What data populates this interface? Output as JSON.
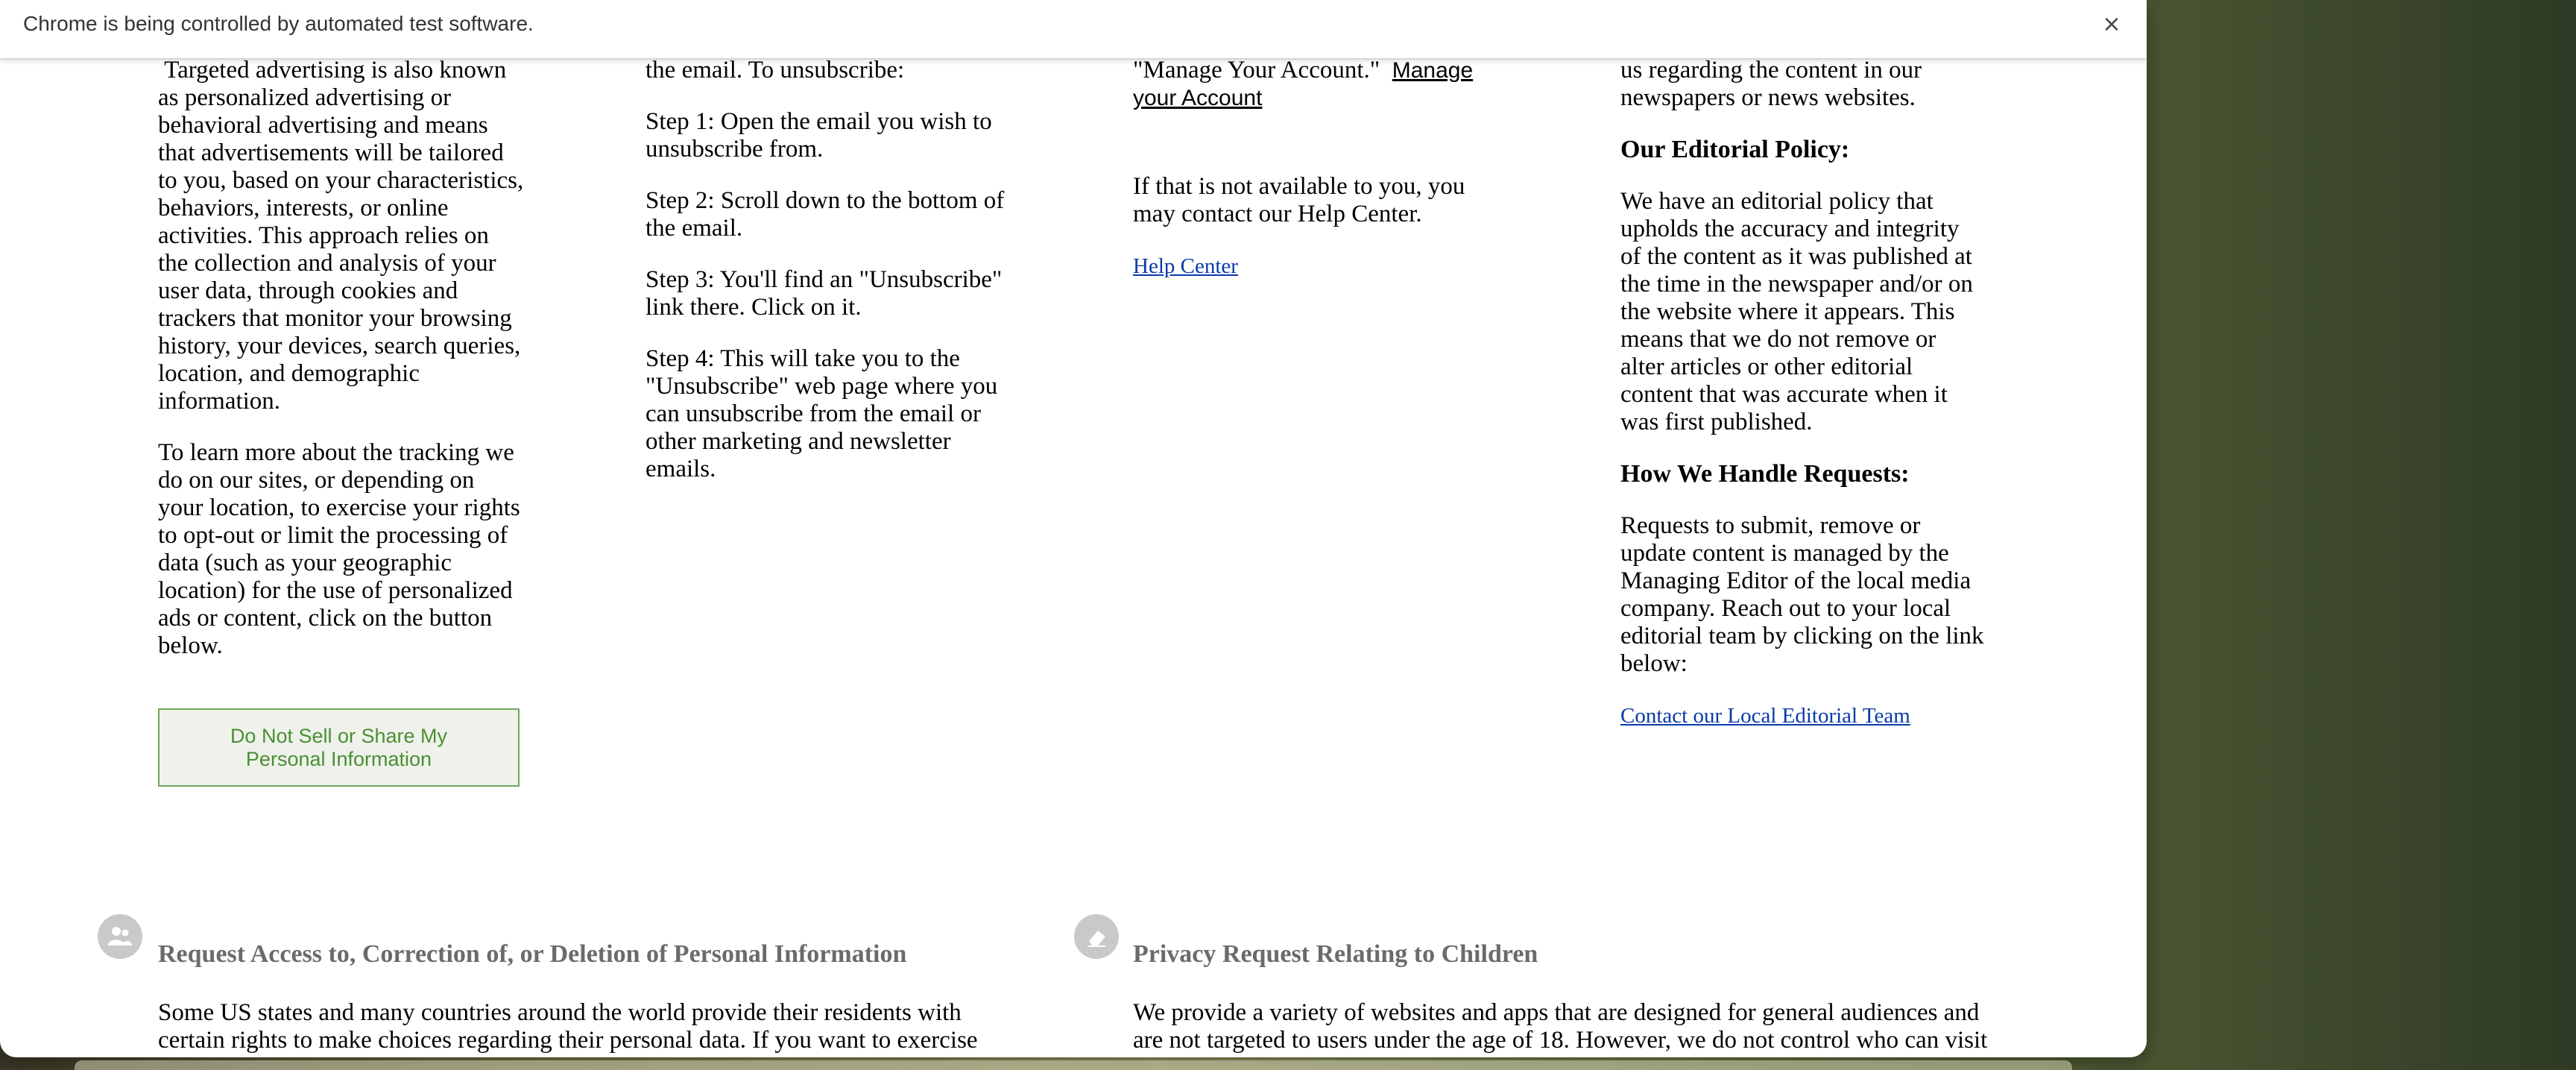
{
  "infobar": {
    "message": "Chrome is being controlled by automated test software.",
    "close_label": "×"
  },
  "col1": {
    "p1": "Targeted advertising is also known as personalized advertising or behavioral advertising and means that advertisements will be tailored to you, based on your characteristics, behaviors, interests, or online activities. This approach relies on the collection and analysis of your user data, through cookies and trackers that monitor your browsing history, your devices, search queries, location, and demographic information.",
    "p2": "To learn more about the tracking we do on our sites, or depending on your location, to exercise your rights to opt-out or limit the processing of data (such as your geographic location) for the use of personalized ads or content, click on the button below.",
    "button_label": "Do Not Sell or Share My Personal Information"
  },
  "col2": {
    "p0": "the email.  To unsubscribe:",
    "step1": "Step 1:  Open the email you wish to unsubscribe from.",
    "step2": "Step 2:  Scroll down to the bottom of the email.",
    "step3": "Step 3:  You'll find an \"Unsubscribe\" link there. Click on it.",
    "step4": "Step 4:  This will take you to the \"Unsubscribe\" web page where you can unsubscribe from the email or other marketing and newsletter emails."
  },
  "col3": {
    "p0_text": "\"Manage Your Account.\"",
    "p0_link": "Manage your Account",
    "p1": "If that is not available to you, you may contact our Help Center.",
    "help_link": "Help Center"
  },
  "col4": {
    "p0": "us regarding the content in our newspapers or news websites.",
    "h1": "Our Editorial Policy:",
    "p1": "We have an editorial policy that upholds the accuracy and integrity of the content as it was published at the time in the newspaper and/or on the website where it appears. This means that we do not remove or alter articles or other editorial content that was accurate when it was first published.",
    "h2": "How We Handle Requests:",
    "p2": "Requests to submit, remove or update content is managed by the Managing Editor of the local media company.  Reach out to your local editorial team by clicking on the link below:",
    "contact_link": "Contact our Local Editorial Team"
  },
  "section_access": {
    "icon": "person-icon",
    "title": "Request Access to, Correction of, or Deletion of Personal Information",
    "body": "Some US states and many countries around the world provide their residents with certain rights to make choices regarding their personal data. If you want to exercise your"
  },
  "section_children": {
    "icon": "eraser-icon",
    "title": "Privacy Request Relating to Children",
    "body": "We provide a variety of websites and apps that are designed for general audiences and are not targeted to users under the age of 18.  However, we do not control who can visit"
  }
}
